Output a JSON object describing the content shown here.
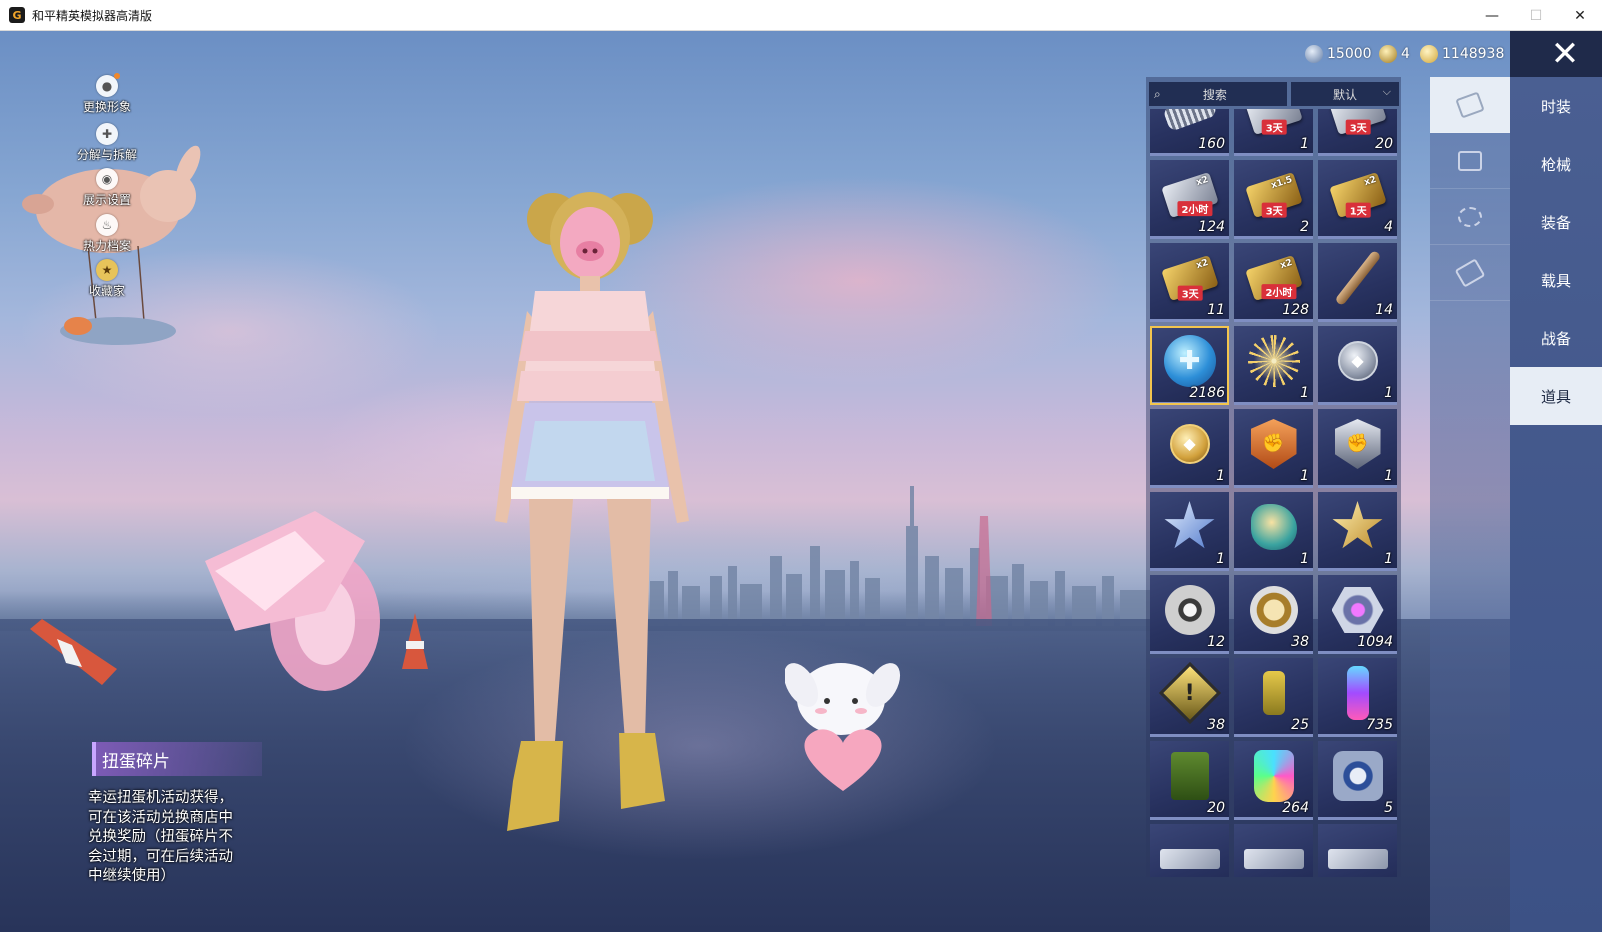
{
  "window": {
    "title": "和平精英模拟器高清版",
    "icon_letter": "G",
    "minimize": "—",
    "maximize": "☐",
    "close": "✕"
  },
  "side_menu": [
    {
      "label": "更换形象",
      "icon": "avatar-icon"
    },
    {
      "label": "分解与拆解",
      "icon": "puzzle-icon"
    },
    {
      "label": "展示设置",
      "icon": "eye-icon"
    },
    {
      "label": "热力档案",
      "icon": "flame-icon"
    },
    {
      "label": "收藏家",
      "icon": "collector-icon"
    }
  ],
  "currency": [
    {
      "value": "15000",
      "color": "#8aa4c9"
    },
    {
      "value": "4",
      "color": "#d7b04a"
    },
    {
      "value": "1148938",
      "color": "#e5c24e"
    }
  ],
  "categories": [
    "时装",
    "枪械",
    "装备",
    "载具",
    "战备",
    "道具"
  ],
  "active_category": "道具",
  "sub_tabs": [
    "card-icon",
    "chest-icon",
    "firework-icon",
    "ticket-icon"
  ],
  "search": {
    "placeholder": "搜索",
    "sort": "默认"
  },
  "items": [
    {
      "type": "spring",
      "count": "160"
    },
    {
      "type": "card-silver",
      "tag": "3天",
      "count": "1"
    },
    {
      "type": "card-silver",
      "tag": "3天",
      "count": "20"
    },
    {
      "type": "card-silver",
      "tag": "2小时",
      "badge": "x2",
      "count": "124"
    },
    {
      "type": "card-gold",
      "tag": "3天",
      "badge": "x1.5",
      "count": "2"
    },
    {
      "type": "card-gold",
      "tag": "1天",
      "badge": "x2",
      "count": "4"
    },
    {
      "type": "card-gold",
      "tag": "3天",
      "badge": "x2",
      "count": "11"
    },
    {
      "type": "card-gold",
      "tag": "2小时",
      "badge": "x2",
      "count": "128"
    },
    {
      "type": "bat",
      "count": "14"
    },
    {
      "type": "orb",
      "count": "2186",
      "selected": true
    },
    {
      "type": "firework",
      "count": "1"
    },
    {
      "type": "medal-silver",
      "count": "1"
    },
    {
      "type": "medal-gold",
      "count": "1"
    },
    {
      "type": "shield-orange",
      "count": "1"
    },
    {
      "type": "shield-silver",
      "count": "1"
    },
    {
      "type": "star-blue",
      "count": "1"
    },
    {
      "type": "dragon",
      "count": "1"
    },
    {
      "type": "star-gold",
      "count": "1"
    },
    {
      "type": "pinwheel",
      "count": "12"
    },
    {
      "type": "gear",
      "count": "38"
    },
    {
      "type": "hexgem",
      "count": "1094"
    },
    {
      "type": "diamond-warn",
      "count": "38"
    },
    {
      "type": "grenade",
      "count": "25"
    },
    {
      "type": "spray",
      "count": "735"
    },
    {
      "type": "jerry",
      "count": "20"
    },
    {
      "type": "paintgun",
      "count": "264"
    },
    {
      "type": "puzzle",
      "count": "5"
    },
    {
      "type": "peek",
      "count": ""
    },
    {
      "type": "peek",
      "count": ""
    },
    {
      "type": "peek",
      "count": ""
    }
  ],
  "selected_item": {
    "name": "扭蛋碎片",
    "desc": [
      "幸运扭蛋机活动获得，",
      "可在该活动兑换商店中",
      "兑换奖励（扭蛋碎片不",
      "会过期，可在后续活动",
      "中继续使用）"
    ]
  }
}
